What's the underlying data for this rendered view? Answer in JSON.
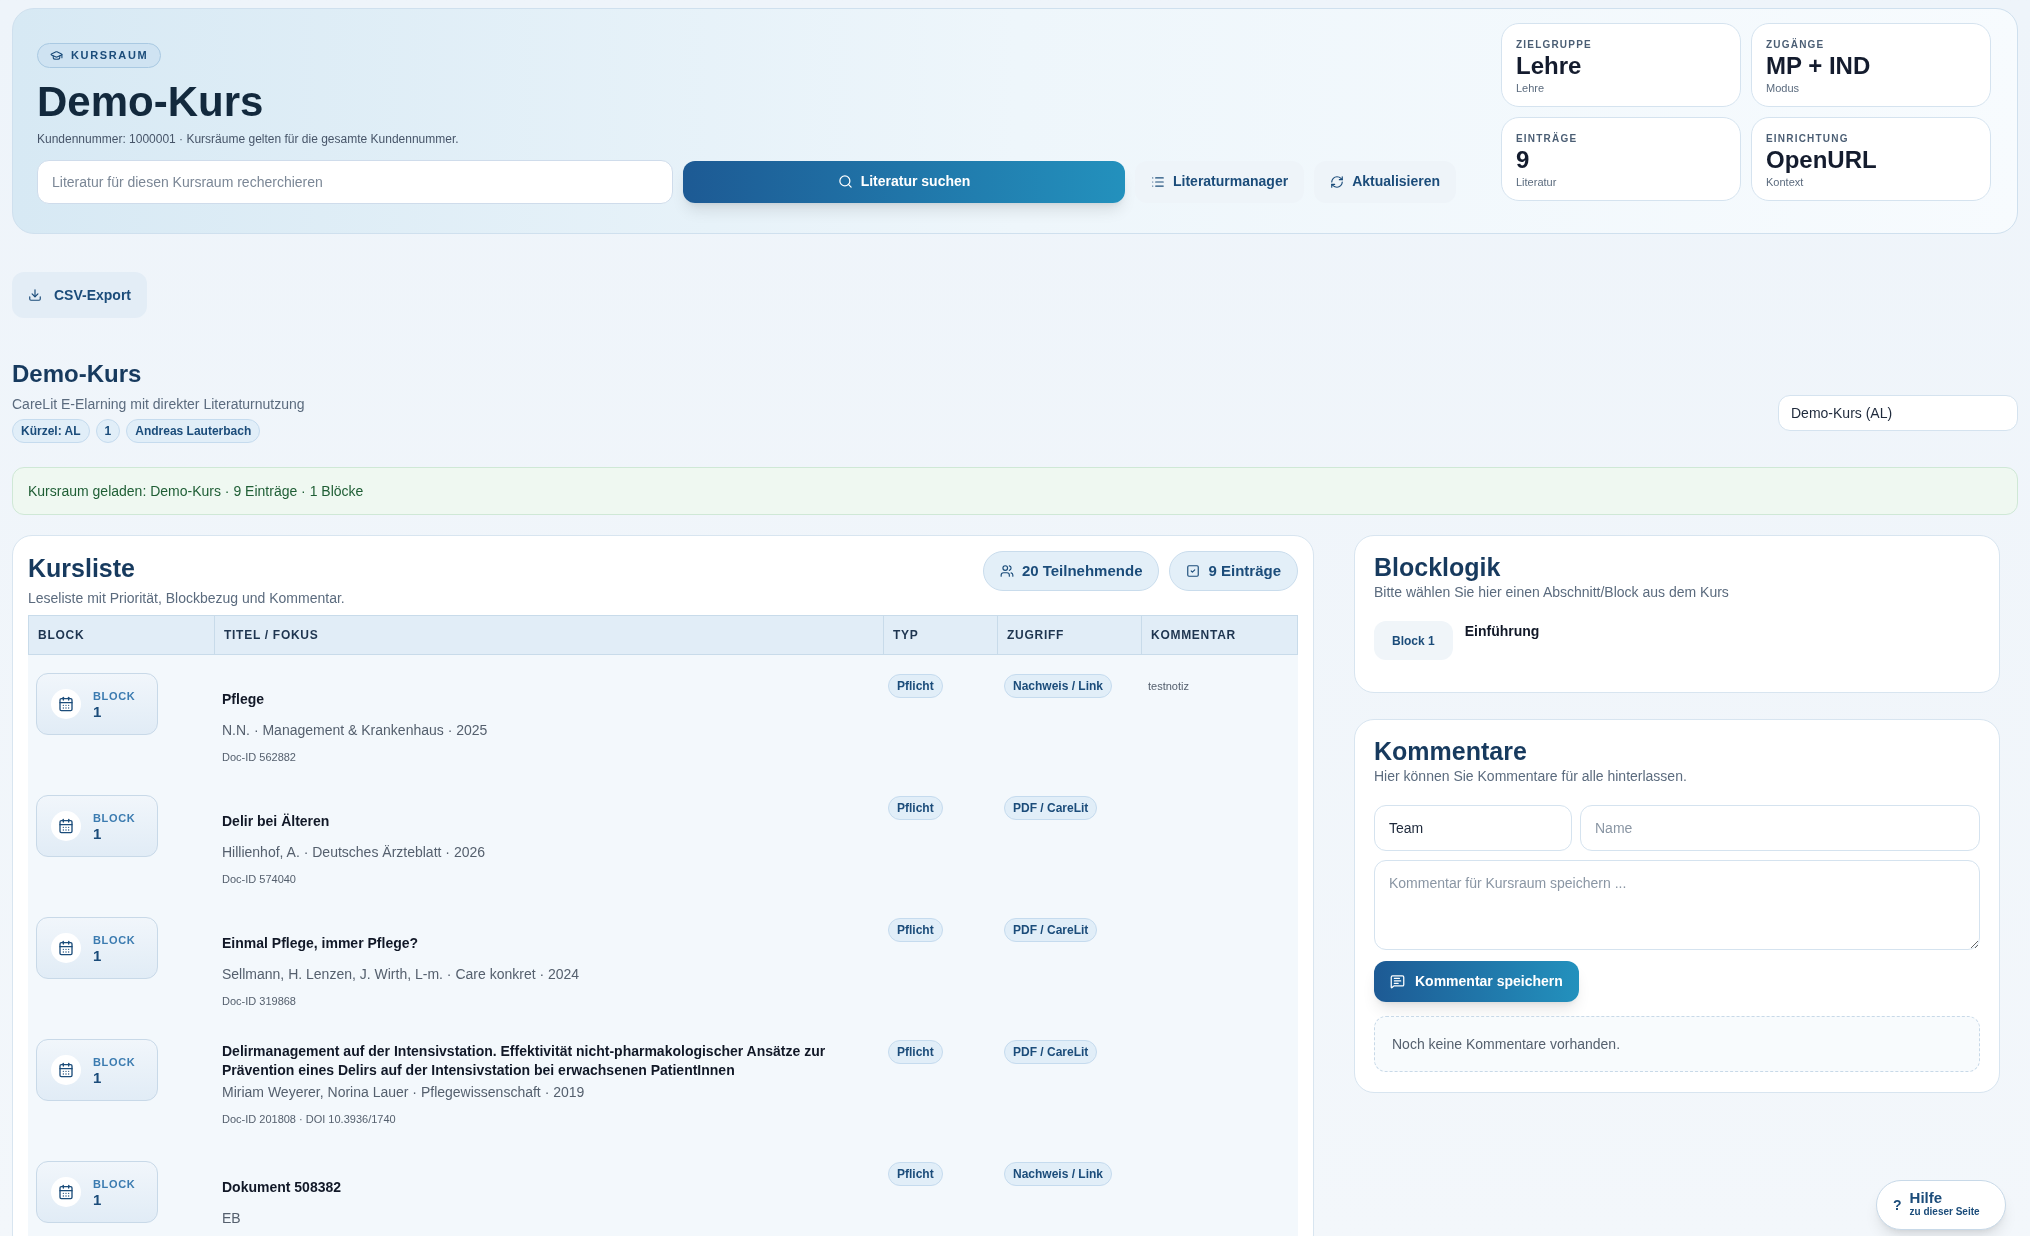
{
  "header": {
    "badge": "KURSRAUM",
    "title": "Demo-Kurs",
    "note": "Kundennummer: 1000001 · Kursräume gelten für die gesamte Kundennummer.",
    "search_placeholder": "Literatur für diesen Kursraum recherchieren",
    "buttons": [
      {
        "kind": "primary",
        "label": "Literatur suchen"
      },
      {
        "kind": "list",
        "label": "Literaturmanager"
      },
      {
        "kind": "refresh",
        "label": "Aktualisieren"
      }
    ],
    "stats": [
      {
        "label": "ZIELGRUPPE",
        "value": "Lehre",
        "caption": "Lehre"
      },
      {
        "label": "ZUGÄNGE",
        "value": "MP + IND",
        "caption": "Modus"
      },
      {
        "label": "EINTRÄGE",
        "value": "9",
        "caption": "Literatur"
      },
      {
        "label": "EINRICHTUNG",
        "value": "OpenURL",
        "caption": "Kontext"
      }
    ]
  },
  "csv_button": "CSV-Export",
  "course": {
    "title": "Demo-Kurs",
    "subtitle": "CareLit E-Elarning mit direkter Literaturnutzung",
    "tags": [
      "Kürzel: AL",
      "1",
      "Andreas Lauterbach"
    ],
    "select_value": "Demo-Kurs (AL)"
  },
  "status": "Kursraum geladen: Demo-Kurs · 9 Einträge · 1 Blöcke",
  "kursliste": {
    "title": "Kursliste",
    "subtitle": "Leseliste mit Priorität, Blockbezug und Kommentar.",
    "counters": [
      {
        "kind": "people",
        "label": "20 Teilnehmende"
      },
      {
        "kind": "entries",
        "label": "9 Einträge"
      }
    ],
    "columns": [
      "BLOCK",
      "TITEL / FOKUS",
      "TYP",
      "ZUGRIFF",
      "KOMMENTAR"
    ],
    "rows": [
      {
        "block_label": "BLOCK",
        "block_number": "1",
        "title": "Pflege",
        "authors": "N.N. · Management & Krankenhaus · 2025",
        "meta": "Doc-ID 562882",
        "type": "Pflicht",
        "access": "Nachweis / Link",
        "comment": "testnotiz"
      },
      {
        "block_label": "BLOCK",
        "block_number": "1",
        "title": "Delir bei Älteren",
        "authors": "Hillienhof, A. · Deutsches Ärzteblatt · 2026",
        "meta": "Doc-ID 574040",
        "type": "Pflicht",
        "access": "PDF / CareLit"
      },
      {
        "block_label": "BLOCK",
        "block_number": "1",
        "title": "Einmal Pflege, immer Pflege?",
        "authors": "Sellmann, H. Lenzen, J. Wirth, L-m. · Care konkret · 2024",
        "meta": "Doc-ID 319868",
        "type": "Pflicht",
        "access": "PDF / CareLit"
      },
      {
        "block_label": "BLOCK",
        "block_number": "1",
        "title": "Delirmanagement auf der Intensivstation. Effektivität nicht-pharmakologischer Ansätze zur Prävention eines Delirs auf der Intensivstation bei erwachsenen PatientInnen",
        "authors": "Miriam Weyerer, Norina Lauer · Pflegewissenschaft · 2019",
        "meta": "Doc-ID 201808 · DOI 10.3936/1740",
        "type": "Pflicht",
        "access": "PDF / CareLit"
      },
      {
        "block_label": "BLOCK",
        "block_number": "1",
        "title": "Dokument 508382",
        "authors": "EB",
        "type": "Pflicht",
        "access": "Nachweis / Link"
      }
    ]
  },
  "blocklogik": {
    "title": "Blocklogik",
    "subtitle": "Bitte wählen Sie hier einen Abschnitt/Block aus dem Kurs",
    "chip": "Block 1",
    "name": "Einführung"
  },
  "comments": {
    "title": "Kommentare",
    "subtitle": "Hier können Sie Kommentare für alle hinterlassen.",
    "team_value": "Team",
    "name_placeholder": "Name",
    "text_placeholder": "Kommentar für Kursraum speichern ...",
    "button": "Kommentar speichern",
    "empty": "Noch keine Kommentare vorhanden."
  },
  "help": {
    "icon": "?",
    "title": "Hilfe",
    "subtitle": "zu dieser Seite"
  }
}
